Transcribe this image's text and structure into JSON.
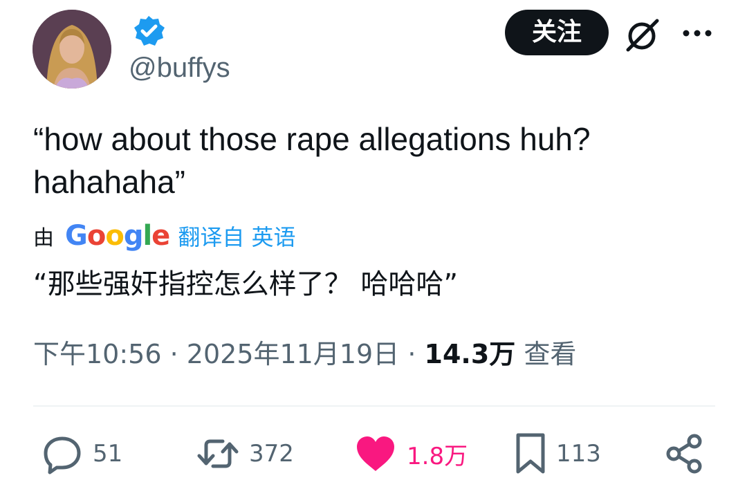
{
  "author": {
    "handle": "@buffys",
    "verified": true,
    "avatar": "profile-photo"
  },
  "header": {
    "follow_label": "关注",
    "icons": [
      "verified-badge-icon",
      "grok-icon",
      "more-icon"
    ]
  },
  "tweet": {
    "text": "“how about those rape allegations huh?\nhahahaha”",
    "translated_by_prefix": "由",
    "translated_by_brand": "Google",
    "translated_from": "翻译自 英语",
    "translated_text": "“那些强奸指控怎么样了？ 哈哈哈”"
  },
  "meta": {
    "time": "下午10:56",
    "separator": "·",
    "date": "2025年11月19日",
    "views_count": "14.3万",
    "views_label": "查看"
  },
  "actions": {
    "replies": "51",
    "reposts": "372",
    "likes": "1.8万",
    "bookmarks": "113"
  },
  "colors": {
    "text": "#0f1419",
    "secondary": "#536471",
    "accent": "#1d9bf0",
    "like": "#f91880",
    "follow_bg": "#0f1419"
  }
}
